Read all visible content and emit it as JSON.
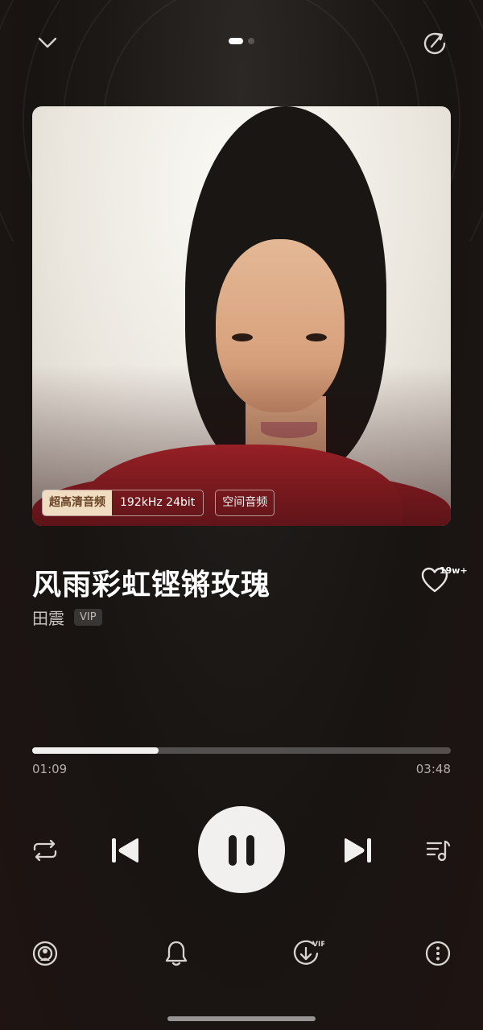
{
  "header": {
    "collapse_icon": "chevron-down-icon",
    "share_icon": "share-icon",
    "page_count": 2,
    "active_page": 1
  },
  "cover": {
    "quality_badge": {
      "label": "超高清音频",
      "spec": "192kHz  24bit"
    },
    "spatial_badge": "空间音频"
  },
  "song": {
    "title": "风雨彩虹铿锵玫瑰",
    "artist": "田震",
    "vip_tag": "VIP",
    "like_count": "19w+"
  },
  "progress": {
    "current": "01:09",
    "total": "03:48",
    "fraction": 0.302
  },
  "controls": {
    "repeat_icon": "repeat-icon",
    "prev_icon": "previous-icon",
    "play_state_icon": "pause-icon",
    "next_icon": "next-icon",
    "playlist_icon": "playlist-icon"
  },
  "bottom_bar": {
    "items": [
      "cast-icon",
      "bell-icon",
      "download-vip-icon",
      "more-icon"
    ],
    "download_badge": "VIP"
  },
  "colors": {
    "background": "#1c1917",
    "accent_gold": "#f0dcc0",
    "progress_fill": "#f2f0ee"
  }
}
